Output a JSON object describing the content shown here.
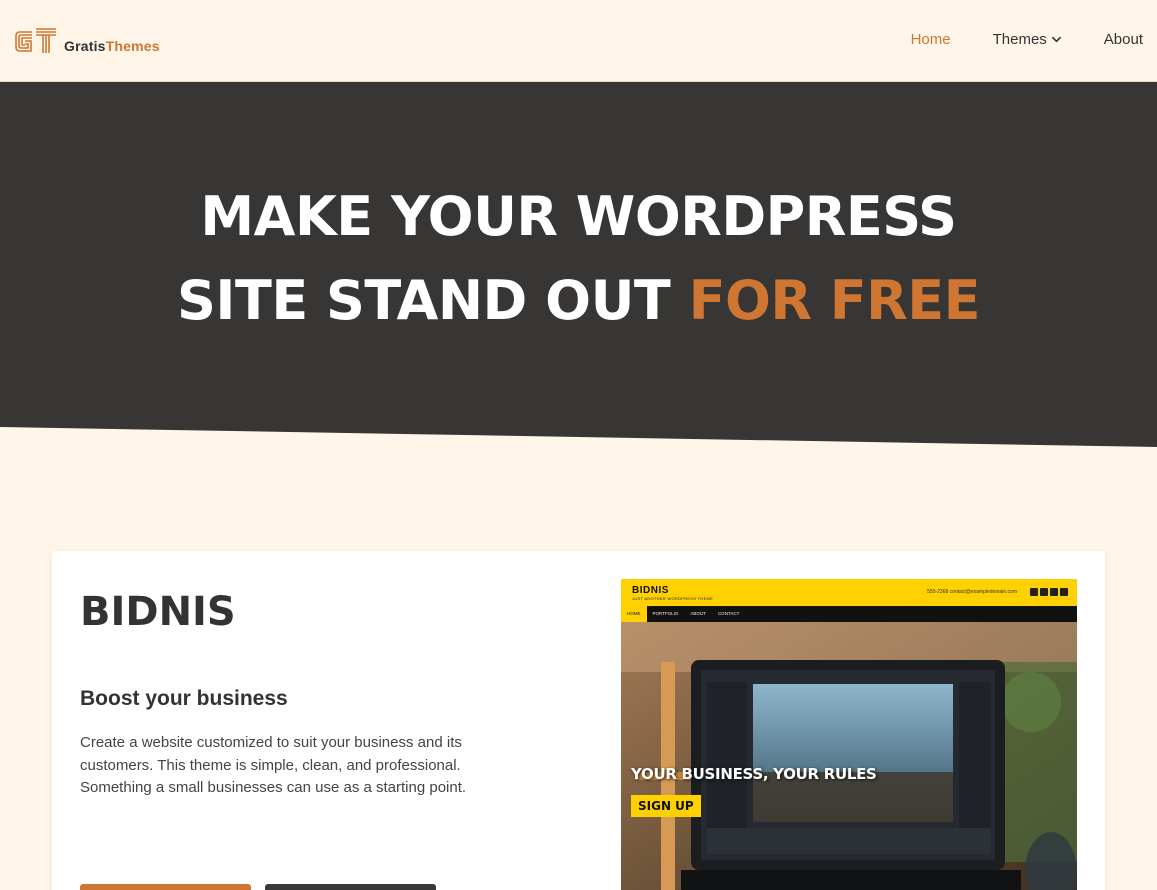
{
  "brand": {
    "monogram": "GT",
    "name_part1": "Gratis",
    "name_part2": "Themes"
  },
  "nav": {
    "items": [
      {
        "label": "Home",
        "active": true
      },
      {
        "label": "Themes",
        "has_dropdown": true
      },
      {
        "label": "About"
      }
    ]
  },
  "hero": {
    "line1": "MAKE YOUR WORDPRESS",
    "line2_prefix": "SITE STAND OUT ",
    "line2_highlight": "FOR FREE"
  },
  "theme_card": {
    "title": "BIDNIS",
    "subtitle": "Boost your business",
    "description": "Create a website customized to suit your business and its customers. This theme is simple, clean, and professional. Something a small businesses can use as a starting point.",
    "preview": {
      "brand": "BIDNIS",
      "tagline": "JUST ANOTHER WORDPRESS THEME",
      "contact": "555-2368   contact@exampledomain.com",
      "nav": [
        "HOME",
        "PORTFOLIO",
        "ABOUT",
        "CONTACT"
      ],
      "headline": "YOUR BUSINESS, YOUR RULES",
      "cta": "SIGN UP"
    }
  },
  "colors": {
    "accent": "#cf7633",
    "hero_bg": "#373635",
    "page_bg": "#fff6e9",
    "preview_yellow": "#ffd100"
  },
  "icons": {
    "dropdown": "chevron-down-icon",
    "logo": "gt-monogram-icon"
  }
}
